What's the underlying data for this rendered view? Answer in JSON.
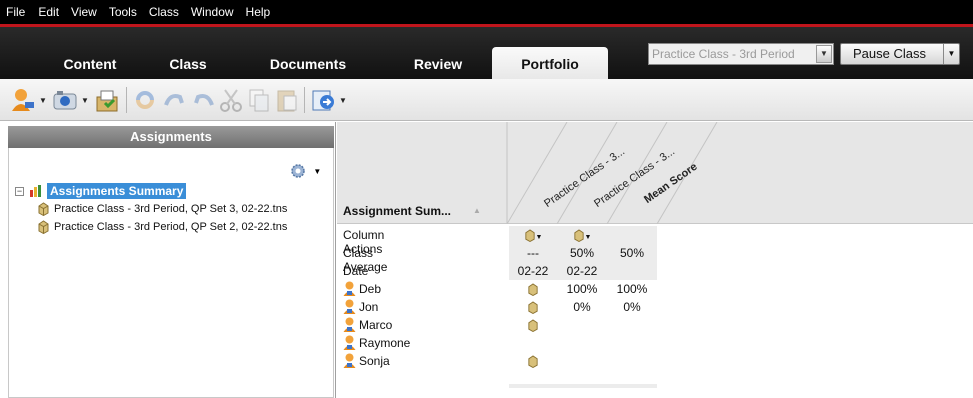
{
  "menu": [
    "File",
    "Edit",
    "View",
    "Tools",
    "Class",
    "Window",
    "Help"
  ],
  "tabs": [
    {
      "label": "Content",
      "active": false
    },
    {
      "label": "Class",
      "active": false
    },
    {
      "label": "Documents",
      "active": false
    },
    {
      "label": "Review",
      "active": false
    },
    {
      "label": "Portfolio",
      "active": true
    }
  ],
  "class_select": {
    "value": "Practice Class - 3rd Period"
  },
  "pause_button": {
    "label": "Pause Class"
  },
  "colors": {
    "accent_red": "#c0151c",
    "selection_blue": "#3a8ed8"
  },
  "left_panel": {
    "title": "Assignments",
    "tree": {
      "root": {
        "label": "Assignments Summary",
        "expander": "−"
      },
      "children": [
        "Practice Class - 3rd Period, QP Set 3, 02-22.tns",
        "Practice Class - 3rd Period, QP Set 2, 02-22.tns"
      ]
    }
  },
  "grid": {
    "sort_header": "Assignment Sum...",
    "column_headers": [
      "Practice Class - 3...",
      "Practice Class - 3...",
      "Mean Score"
    ],
    "rows": {
      "column_actions": {
        "label": "Column Actions"
      },
      "class_average": {
        "label": "Class Average",
        "values": [
          "---",
          "50%",
          "50%"
        ]
      },
      "date": {
        "label": "Date",
        "values": [
          "02-22",
          "02-22",
          ""
        ]
      }
    },
    "students": [
      {
        "name": "Deb",
        "col1_icon": true,
        "col2": "100%",
        "mean": "100%"
      },
      {
        "name": "Jon",
        "col1_icon": true,
        "col2": "0%",
        "mean": "0%"
      },
      {
        "name": "Marco",
        "col1_icon": true,
        "col2": "",
        "mean": ""
      },
      {
        "name": "Raymone",
        "col1_icon": false,
        "col2": "",
        "mean": ""
      },
      {
        "name": "Sonja",
        "col1_icon": true,
        "col2": "",
        "mean": ""
      }
    ]
  }
}
